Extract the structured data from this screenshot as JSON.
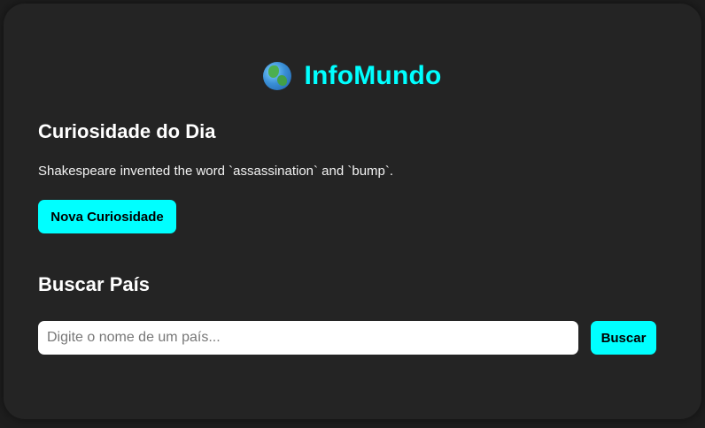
{
  "app": {
    "title": "InfoMundo",
    "icon": "globe-icon",
    "accent_color": "#00ffff",
    "background_color": "#242424"
  },
  "curiosity": {
    "heading": "Curiosidade do Dia",
    "fact_text": "Shakespeare invented the word `assassination` and `bump`.",
    "new_button_label": "Nova Curiosidade"
  },
  "search": {
    "heading": "Buscar País",
    "placeholder": "Digite o nome de um país...",
    "value": "",
    "button_label": "Buscar"
  }
}
